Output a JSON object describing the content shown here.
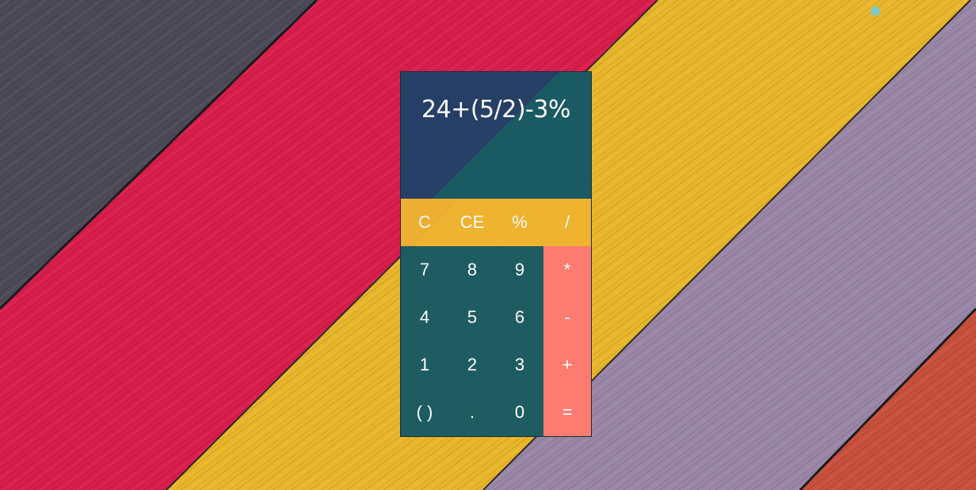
{
  "display": {
    "expression": "24+(5/2)-3%"
  },
  "keys": {
    "top_row": [
      "C",
      "CE",
      "%",
      "/"
    ],
    "row1": [
      "7",
      "8",
      "9",
      "*"
    ],
    "row2": [
      "4",
      "5",
      "6",
      "-"
    ],
    "row3": [
      "1",
      "2",
      "3",
      "+"
    ],
    "row4": [
      "( )",
      ".",
      "0",
      "="
    ]
  },
  "colors": {
    "display_left": "#253f66",
    "display_right": "#1a5a62",
    "function_row": "#efb431",
    "number_keys": "#1d5c60",
    "operator_keys": "#fe7b70"
  },
  "background": {
    "description_icon": "wood-planks"
  }
}
